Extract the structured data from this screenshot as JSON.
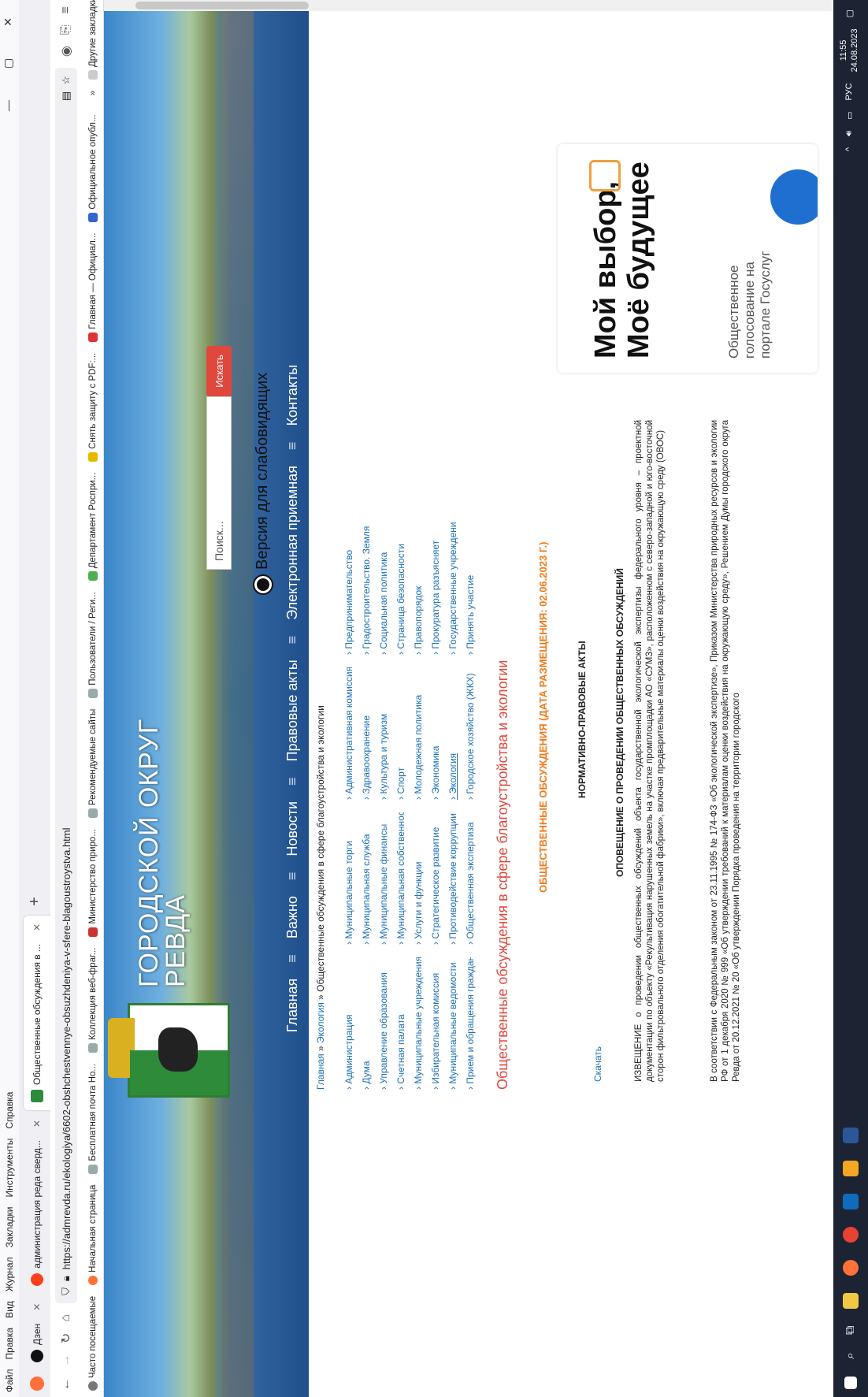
{
  "menubar": [
    "Файл",
    "Правка",
    "Вид",
    "Журнал",
    "Закладки",
    "Инструменты",
    "Справка"
  ],
  "tabs": [
    {
      "label": "Дзен",
      "icon": "dzen-icon",
      "active": false
    },
    {
      "label": "администрация реда сверд...",
      "icon": "yandex-icon",
      "active": false
    },
    {
      "label": "Общественные обсуждения в ...",
      "icon": "site-icon",
      "active": true
    }
  ],
  "url": "https://admrevda.ru/ekologiya/6602-obshchestvennye-obsuzhdeniya-v-sfere-blagoustroystva.html",
  "bookmarks": [
    "Часто посещаемые",
    "Начальная страница",
    "Бесплатная почта Ho...",
    "Коллекция веб-фраг...",
    "Министерство приро...",
    "Рекомендуемые сайты",
    "Пользователи / Реги...",
    "Департамент Роспри...",
    "Снять защиту с PDF:...",
    "Главная — Официал...",
    "Официальное опубл..."
  ],
  "bookmarks_other": "Другие закладки",
  "site": {
    "title_line1": "ГОРОДСКОЙ ОКРУГ",
    "title_line2": "РЕВДА",
    "eye_version": "Версия для слабовидящих",
    "search_placeholder": "Поиск...",
    "search_button": "Искать",
    "nav": [
      "Главная",
      "Важно",
      "Новости",
      "Правовые акты",
      "Электронная приемная",
      "Контакты"
    ]
  },
  "breadcrumb": {
    "home": "Главная",
    "section": "Экология",
    "current": "Общественные обсуждения в сфере благоустройства и экологии"
  },
  "menu": [
    [
      "Администрация",
      "Дума",
      "Управление образования",
      "Счетная палата",
      "Муниципальные учреждения",
      "Избирательная комиссия",
      "Муниципальные ведомости",
      "Прием и обращения граждан"
    ],
    [
      "Муниципальные торги",
      "Муниципальная служба",
      "Муниципальные финансы",
      "Муниципальная собственность",
      "Услуги и функции",
      "Стратегическое развитие",
      "Противодействие коррупции",
      "Общественная экспертиза"
    ],
    [
      "Административная комиссия",
      "Здравоохранение",
      "Культура и туризм",
      "Спорт",
      "Молодежная политика",
      "Экономика",
      "Экология",
      "Городское хозяйство (ЖКХ)"
    ],
    [
      "Предпринимательство",
      "Градостроительство. Земля",
      "Социальная политика",
      "Страница безопасности",
      "Правопорядок",
      "Прокуратура разъясняет",
      "Государственные учреждения",
      "Принять участие"
    ]
  ],
  "article": {
    "title": "Общественные обсуждения в сфере благоустройства и экологии",
    "date_heading": "ОБЩЕСТВЕННЫЕ ОБСУЖДЕНИЯ (ДАТА РАЗМЕЩЕНИЯ: 02.06.2023 Г.)",
    "npa_heading": "НОРМАТИВНО-ПРАВОВЫЕ АКТЫ",
    "download": "Скачать",
    "notice_heading": "ОПОВЕЩЕНИЕ О ПРОВЕДЕНИИ ОБЩЕСТВЕННЫХ ОБСУЖДЕНИЙ",
    "notice_text": "ИЗВЕЩЕНИЕ о проведении общественных обсуждений объекта государственной экологической экспертизы федерального уровня – проектной документации по объекту «Рекультивация нарушенных земель на участке промплощадки АО «СУМЗ», расположенном с северо-западной и юго-восточной сторон фильтровального отделения обогатительной фабрики», включая предварительные материалы оценки воздействия на окружающую среду (ОВОС)",
    "law_text": "В соответствии с Федеральным законом от 23.11.1995 № 174-ФЗ «Об экологической экспертизе», Приказом Министерства природных ресурсов и экологии РФ от 1 декабря 2020 № 999 «Об утверждении требований к материалам оценки воздействия на окружающую среду», Решением Думы городского округа Ревда от 20.12.2021 № 20 «Об утверждении Порядка проведения на территории городского"
  },
  "promo": {
    "big": "Мой выбор, Моё будущее",
    "small": "Общественное голосование на портале Госуслуг"
  },
  "tray": {
    "lang": "РУС",
    "time": "11:55",
    "date": "24.08.2023"
  },
  "colors": {
    "accent_red": "#e0483e",
    "link": "#1a6fb5",
    "date_orange": "#f07a1a"
  }
}
